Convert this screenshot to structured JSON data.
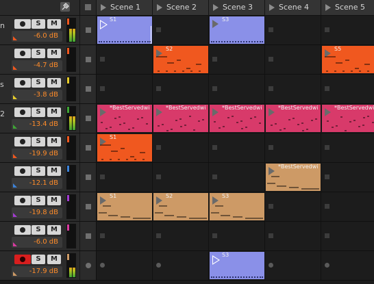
{
  "header": {
    "scenes": [
      "Scene 1",
      "Scene 2",
      "Scene 3",
      "Scene 4",
      "Scene 5"
    ]
  },
  "colors": {
    "blue": "#8a90e8",
    "orange": "#f0581f",
    "pink": "#d83a6a",
    "tan": "#cd9a66",
    "vol_text": "#ff8c2a"
  },
  "tracks": [
    {
      "name": "n",
      "volume": "-6.0 dB",
      "color": "#f0581f",
      "armed": false,
      "clips": [
        {
          "scene": 1,
          "name": "S1",
          "color": "#8a90e8",
          "playing": true
        },
        {
          "scene": 3,
          "name": "S3",
          "color": "#8a90e8"
        }
      ]
    },
    {
      "name": "",
      "volume": "-4.7 dB",
      "color": "#f0581f",
      "armed": false,
      "clips": [
        {
          "scene": 2,
          "name": "S2",
          "color": "#f0581f"
        },
        {
          "scene": 5,
          "name": "S5",
          "color": "#f0581f"
        }
      ]
    },
    {
      "name": "s",
      "volume": "-3.8 dB",
      "color": "#e6cc2a",
      "armed": false,
      "clips": []
    },
    {
      "name": "2",
      "volume": "-13.4 dB",
      "color": "#3fa535",
      "armed": false,
      "clips": [
        {
          "scene": 1,
          "name": "*BestServedwi",
          "color": "#d83a6a"
        },
        {
          "scene": 2,
          "name": "*BestServedwi",
          "color": "#d83a6a"
        },
        {
          "scene": 3,
          "name": "*BestServedwi",
          "color": "#d83a6a"
        },
        {
          "scene": 4,
          "name": "*BestServedwi",
          "color": "#d83a6a"
        },
        {
          "scene": 5,
          "name": "*BestServedwi",
          "color": "#d83a6a"
        }
      ]
    },
    {
      "name": "",
      "volume": "-19.9 dB",
      "color": "#f0581f",
      "armed": false,
      "clips": [
        {
          "scene": 1,
          "name": "S1",
          "color": "#f0581f"
        }
      ]
    },
    {
      "name": "",
      "volume": "-12.1 dB",
      "color": "#3c82d8",
      "armed": false,
      "clips": [
        {
          "scene": 4,
          "name": "*BestServedwi",
          "color": "#cd9a66"
        }
      ]
    },
    {
      "name": "",
      "volume": "-19.8 dB",
      "color": "#a23bd0",
      "armed": false,
      "clips": [
        {
          "scene": 1,
          "name": "S1",
          "color": "#cd9a66"
        },
        {
          "scene": 2,
          "name": "S2",
          "color": "#cd9a66"
        },
        {
          "scene": 3,
          "name": "S3",
          "color": "#cd9a66"
        }
      ]
    },
    {
      "name": "",
      "volume": "-6.0 dB",
      "color": "#d83aa0",
      "armed": false,
      "clips": []
    },
    {
      "name": "",
      "volume": "-17.9 dB",
      "color": "#cd9a66",
      "armed": true,
      "clips": [
        {
          "scene": 3,
          "name": "S3",
          "color": "#8a90e8",
          "playing": true
        }
      ]
    }
  ],
  "buttons": {
    "solo": "S",
    "mute": "M"
  }
}
